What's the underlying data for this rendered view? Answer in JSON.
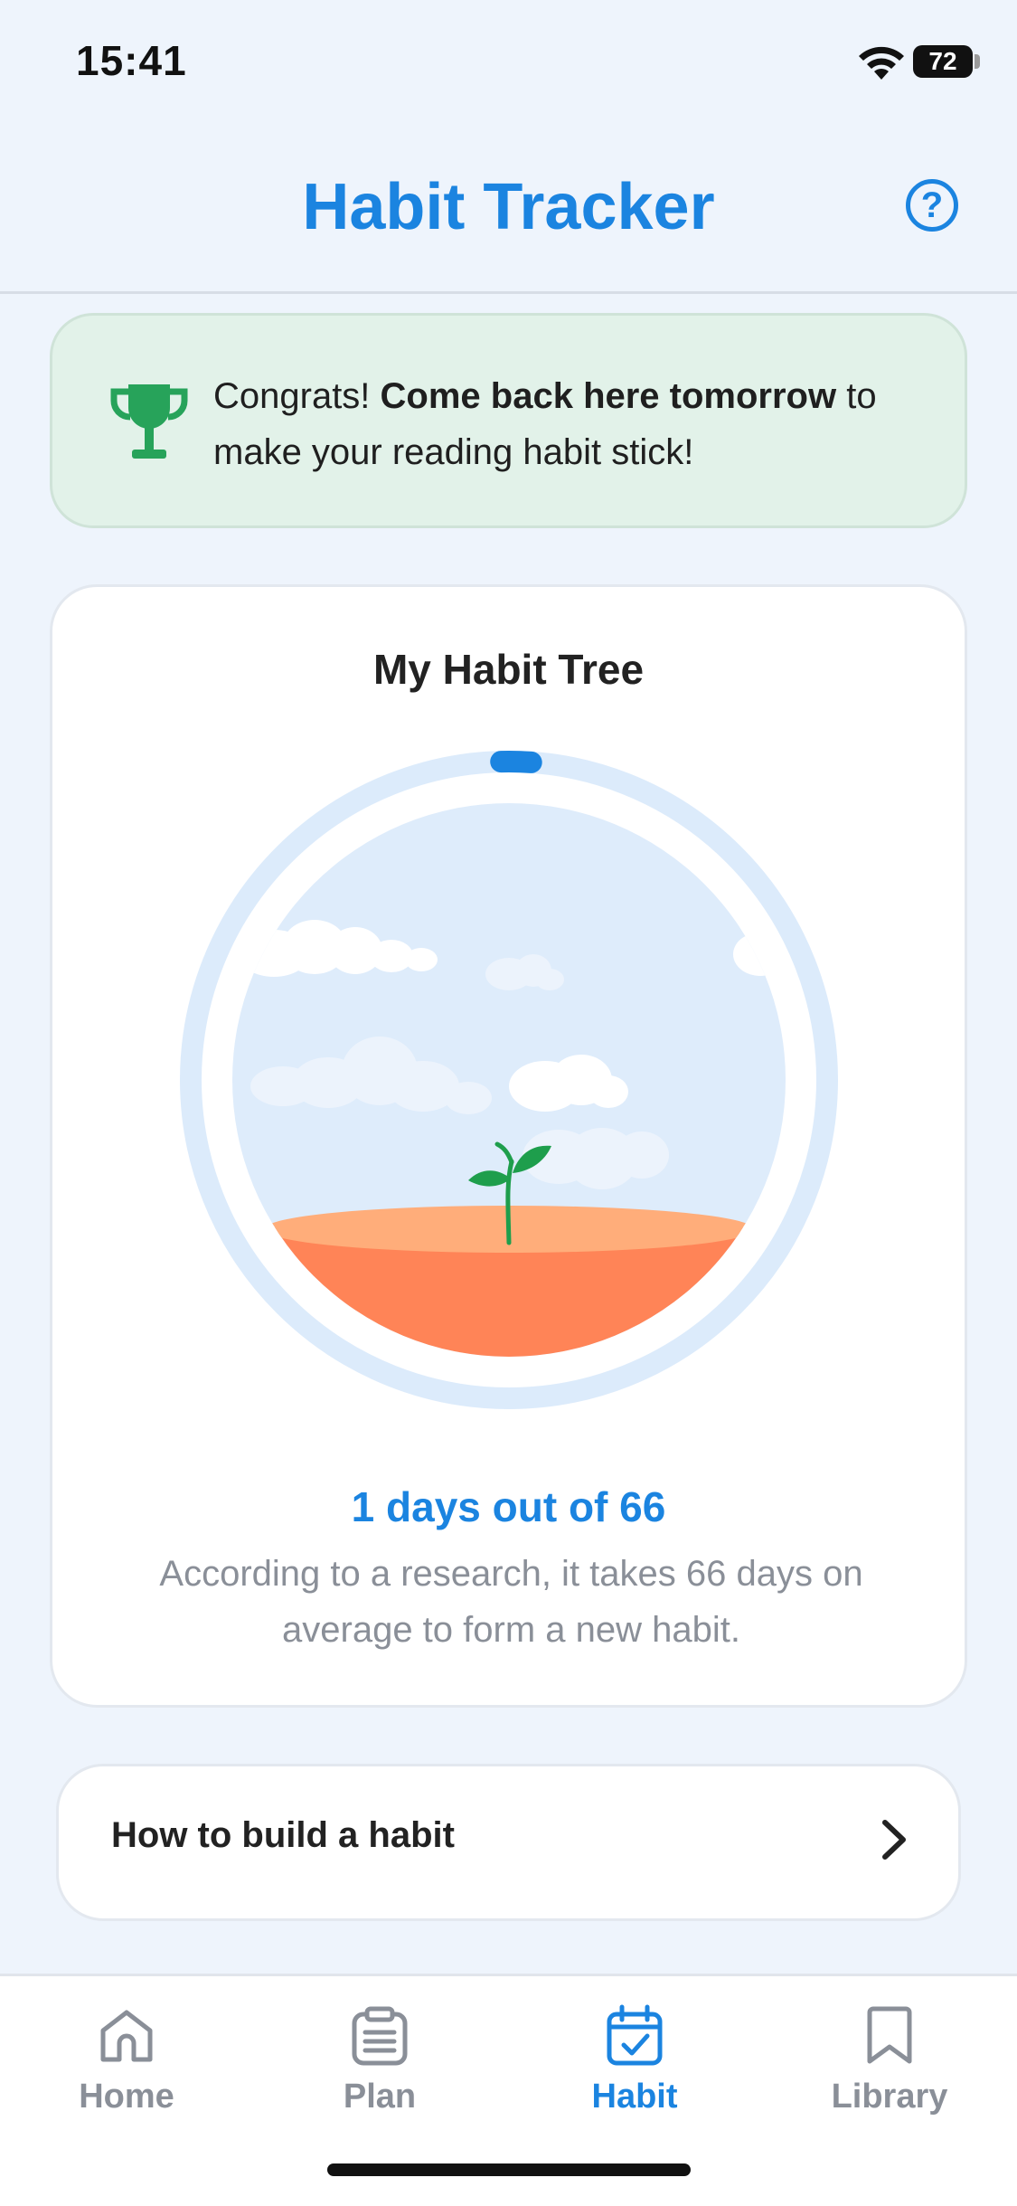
{
  "status_bar": {
    "time": "15:41",
    "battery": "72"
  },
  "header": {
    "title": "Habit Tracker",
    "help_symbol": "?"
  },
  "banner": {
    "icon": "trophy-icon",
    "text_intro": "Congrats! ",
    "text_bold": "Come back here tomorrow",
    "text_rest": " to make your reading habit stick!"
  },
  "habit_tree": {
    "title": "My Habit Tree",
    "days_completed": 1,
    "days_total": 66,
    "days_label": "1 days out of 66",
    "research_text": "According to a research, it takes 66 days on average to form a new habit."
  },
  "build_card": {
    "label": "How to build a habit"
  },
  "tabs": [
    {
      "label": "Home",
      "icon": "home-icon",
      "active": false
    },
    {
      "label": "Plan",
      "icon": "clipboard-icon",
      "active": false
    },
    {
      "label": "Habit",
      "icon": "calendar-check-icon",
      "active": true
    },
    {
      "label": "Library",
      "icon": "bookmark-icon",
      "active": false
    }
  ],
  "colors": {
    "accent": "#1b84e0",
    "banner_bg": "#e2f2e9",
    "trophy": "#27a35a",
    "soil": "#ff8457",
    "soil_top": "#ffad7a",
    "sky": "#deecfb",
    "ring": "#dcebfb"
  }
}
